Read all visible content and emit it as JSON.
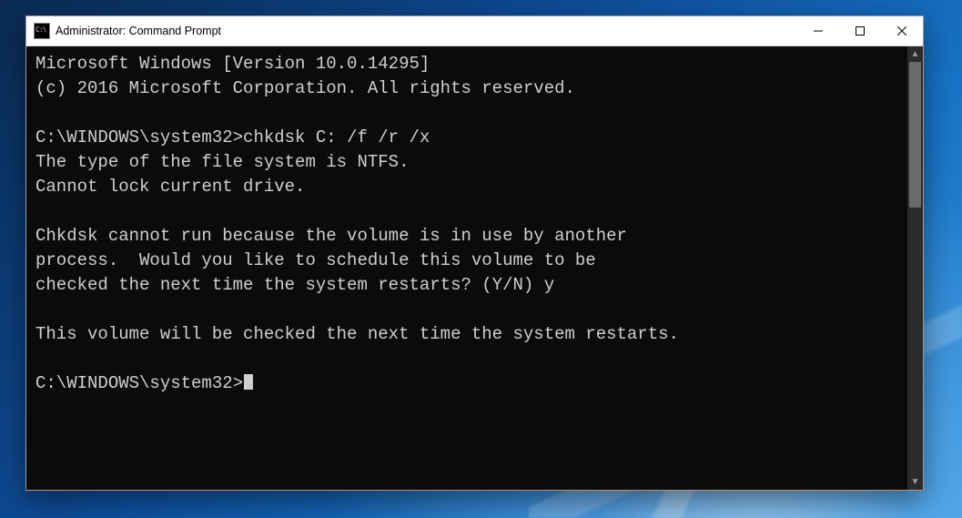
{
  "window": {
    "title": "Administrator: Command Prompt",
    "icon": "cmd-icon"
  },
  "terminal": {
    "lines": [
      "Microsoft Windows [Version 10.0.14295]",
      "(c) 2016 Microsoft Corporation. All rights reserved.",
      "",
      "C:\\WINDOWS\\system32>chkdsk C: /f /r /x",
      "The type of the file system is NTFS.",
      "Cannot lock current drive.",
      "",
      "Chkdsk cannot run because the volume is in use by another",
      "process.  Would you like to schedule this volume to be",
      "checked the next time the system restarts? (Y/N) y",
      "",
      "This volume will be checked the next time the system restarts.",
      ""
    ],
    "prompt": "C:\\WINDOWS\\system32>"
  },
  "controls": {
    "minimize": "Minimize",
    "maximize": "Maximize",
    "close": "Close"
  },
  "scrollbar": {
    "up_glyph": "▲",
    "down_glyph": "▼"
  }
}
